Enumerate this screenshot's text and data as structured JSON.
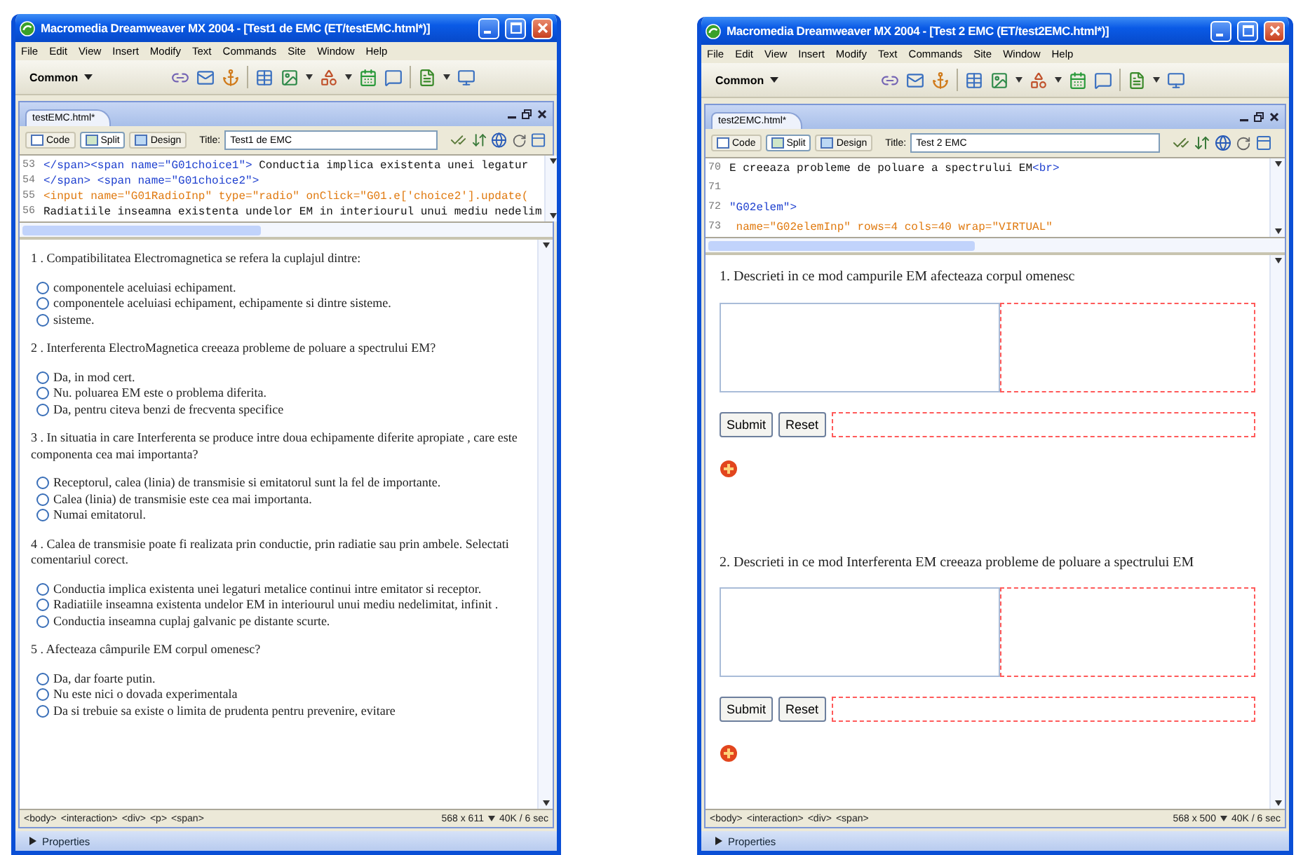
{
  "windows": [
    {
      "title": "Macromedia Dreamweaver MX 2004 - [Test1 de EMC (ET/testEMC.html*)]",
      "menu": [
        "File",
        "Edit",
        "View",
        "Insert",
        "Modify",
        "Text",
        "Commands",
        "Site",
        "Window",
        "Help"
      ],
      "insert_category": "Common",
      "document": {
        "tab": "testEMC.html*",
        "views": [
          {
            "label": "Code",
            "selected": false
          },
          {
            "label": "Split",
            "selected": true
          },
          {
            "label": "Design",
            "selected": false
          }
        ],
        "title_label": "Title:",
        "title_value": "Test1 de EMC",
        "code_lines": [
          {
            "number": "53",
            "segments": [
              {
                "kind": "tag",
                "text": "</span><span name=\"G01choice1\">"
              },
              {
                "kind": "text",
                "text": " Conductia implica existenta unei legatur"
              }
            ]
          },
          {
            "number": "54",
            "segments": [
              {
                "kind": "tag",
                "text": "</span> <span name=\"G01choice2\">"
              }
            ]
          },
          {
            "number": "55",
            "segments": [
              {
                "kind": "attr",
                "text": "<input name=\"G01RadioInp\" type=\"radio\" onClick=\"G01.e['choice2'].update("
              }
            ]
          },
          {
            "number": "56",
            "segments": [
              {
                "kind": "text",
                "text": "Radiatiile inseamna existenta undelor EM in interiourul unui mediu nedelim"
              }
            ]
          }
        ],
        "questions": [
          {
            "kind": "choice",
            "text": "1 . Compatibilitatea Electromagnetica se refera la cuplajul dintre:",
            "options": [
              {
                "text": "componentele aceluiasi echipament.",
                "selected": false
              },
              {
                "text": "componentele aceluiasi echipament, echipamente si dintre sisteme.",
                "selected": false
              },
              {
                "text": "sisteme.",
                "selected": false
              }
            ]
          },
          {
            "kind": "choice",
            "text": "2 . Interferenta ElectroMagnetica creeaza probleme de poluare a spectrului EM?",
            "options": [
              {
                "text": "Da, in mod cert.",
                "selected": false
              },
              {
                "text": "Nu. poluarea EM este o problema diferita.",
                "selected": false
              },
              {
                "text": "Da, pentru citeva benzi de frecventa specifice",
                "selected": false
              }
            ]
          },
          {
            "kind": "choice",
            "text": "3 . In situatia in care Interferenta se produce intre doua echipamente diferite apropiate , care este componenta cea mai importanta?",
            "options": [
              {
                "text": "Receptorul, calea (linia) de transmisie si emitatorul sunt la fel de importante.",
                "selected": false
              },
              {
                "text": "Calea (linia) de transmisie este cea mai importanta.",
                "selected": false
              },
              {
                "text": "Numai emitatorul.",
                "selected": false
              }
            ]
          },
          {
            "kind": "choice",
            "text": "4 . Calea de transmisie poate fi realizata prin conductie, prin radiatie sau prin ambele. Selectati comentariul corect.",
            "options": [
              {
                "text": "Conductia implica existenta unei legaturi metalice continui intre emitator si receptor.",
                "selected": false
              },
              {
                "text": "Radiatiile inseamna existenta undelor EM in interiourul unui mediu nedelimitat, infinit .",
                "selected": false
              },
              {
                "text": "Conductia inseamna cuplaj galvanic pe distante scurte.",
                "selected": false
              }
            ]
          },
          {
            "kind": "choice",
            "text": "5 . Afecteaza câmpurile EM corpul omenesc?",
            "options": [
              {
                "text": "Da, dar foarte putin.",
                "selected": false
              },
              {
                "text": "Nu este nici o dovada experimentala",
                "selected": false
              },
              {
                "text": "Da si trebuie sa existe o limita de prudenta pentru prevenire, evitare",
                "selected": false
              }
            ]
          }
        ]
      },
      "tag_selector": [
        "<body>",
        "<interaction>",
        "<div>",
        "<p>",
        "<span>"
      ],
      "page_size": "568 x 611",
      "download": "40K / 6 sec",
      "properties": "Properties"
    },
    {
      "title": "Macromedia Dreamweaver MX 2004 - [Test 2 EMC (ET/test2EMC.html*)]",
      "menu": [
        "File",
        "Edit",
        "View",
        "Insert",
        "Modify",
        "Text",
        "Commands",
        "Site",
        "Window",
        "Help"
      ],
      "insert_category": "Common",
      "document": {
        "tab": "test2EMC.html*",
        "views": [
          {
            "label": "Code",
            "selected": false
          },
          {
            "label": "Split",
            "selected": true
          },
          {
            "label": "Design",
            "selected": false
          }
        ],
        "title_label": "Title:",
        "title_value": "Test 2 EMC",
        "code_lines": [
          {
            "number": "70",
            "segments": [
              {
                "kind": "text",
                "text": "E creeaza probleme de poluare a spectrului EM"
              },
              {
                "kind": "tag",
                "text": "<br>"
              }
            ]
          },
          {
            "number": "71"
          },
          {
            "number": "72",
            "segments": [
              {
                "kind": "tag",
                "text": "\"G02elem\">"
              }
            ]
          },
          {
            "number": "73",
            "segments": [
              {
                "kind": "attr",
                "text": " name=\"G02elemInp\" rows=4 cols=40 wrap=\"VIRTUAL\""
              }
            ]
          }
        ],
        "questions": [
          {
            "kind": "essay",
            "text": "1. Descrieti in ce mod campurile EM afecteaza corpul omenesc",
            "buttons": [
              "Submit",
              "Reset"
            ]
          },
          {
            "kind": "essay",
            "text": "2. Descrieti in ce mod Interferenta EM creeaza probleme de poluare a spectrului EM",
            "buttons": [
              "Submit",
              "Reset"
            ]
          }
        ]
      },
      "tag_selector": [
        "<body>",
        "<interaction>",
        "<div>",
        "<span>"
      ],
      "page_size": "568 x 500",
      "download": "40K / 6 sec",
      "properties": "Properties"
    }
  ]
}
